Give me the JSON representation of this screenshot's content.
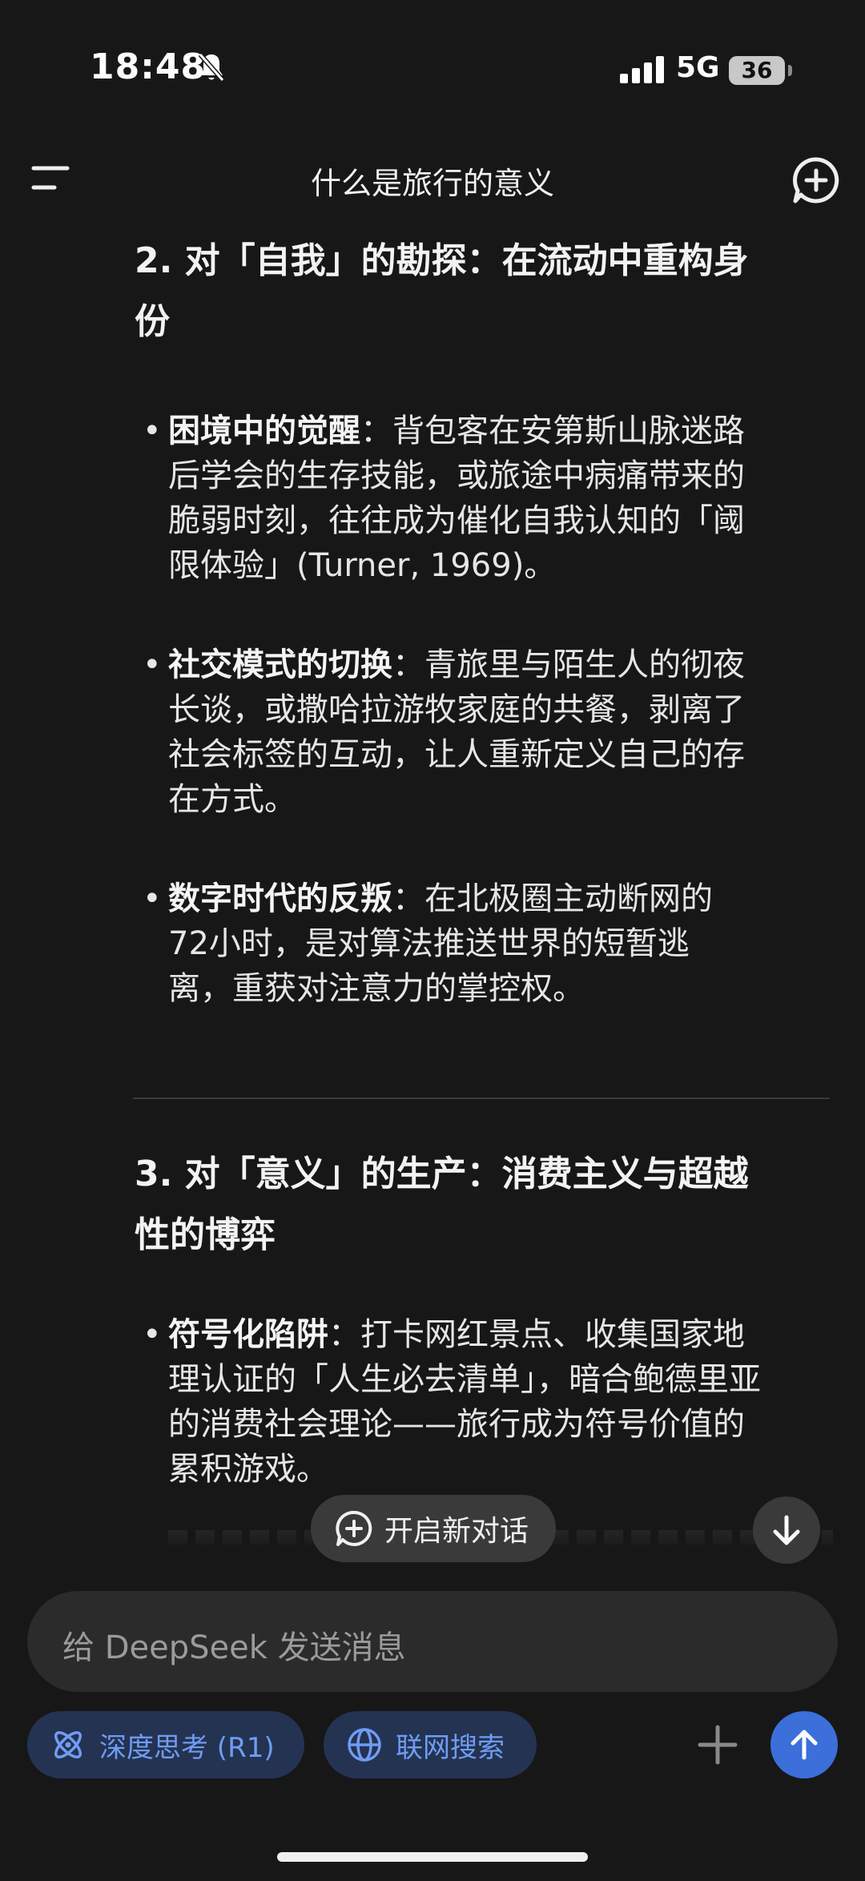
{
  "status_bar": {
    "time": "18:48",
    "network": "5G",
    "battery": "36"
  },
  "header": {
    "title": "什么是旅行的意义"
  },
  "content": {
    "section2": {
      "title_line1": "2. 对「自我」的勘探：在流动中重构身",
      "title_line2": "份",
      "items": [
        {
          "bold": "困境中的觉醒",
          "lines": [
            "：背包客在安第斯山脉迷路",
            "后学会的生存技能，或旅途中病痛带来的",
            "脆弱时刻，往往成为催化自我认知的「阈",
            "限体验」(Turner, 1969)。"
          ]
        },
        {
          "bold": "社交模式的切换",
          "lines": [
            "：青旅里与陌生人的彻夜",
            "长谈，或撒哈拉游牧家庭的共餐，剥离了",
            "社会标签的互动，让人重新定义自己的存",
            "在方式。"
          ]
        },
        {
          "bold": "数字时代的反叛",
          "lines": [
            "：在北极圈主动断网的",
            "72小时，是对算法推送世界的短暂逃",
            "离，重获对注意力的掌控权。"
          ]
        }
      ]
    },
    "section3": {
      "title_line1": "3. 对「意义」的生产：消费主义与超越",
      "title_line2": "性的博弈",
      "items": [
        {
          "bold": "符号化陷阱",
          "lines": [
            "：打卡网红景点、收集国家地",
            "理认证的「人生必去清单」，暗合鲍德里亚",
            "的消费社会理论——旅行成为符号价值的",
            "累积游戏。"
          ]
        }
      ]
    }
  },
  "floating": {
    "new_chat_label": "开启新对话"
  },
  "composer": {
    "placeholder": "给 DeepSeek 发送消息",
    "deep_think_label": "深度思考 (R1)",
    "web_search_label": "联网搜索"
  },
  "colors": {
    "background": "#171717",
    "chip_bg": "#243352",
    "chip_text": "#6f9cf5",
    "send_button": "#3b6fd9"
  }
}
